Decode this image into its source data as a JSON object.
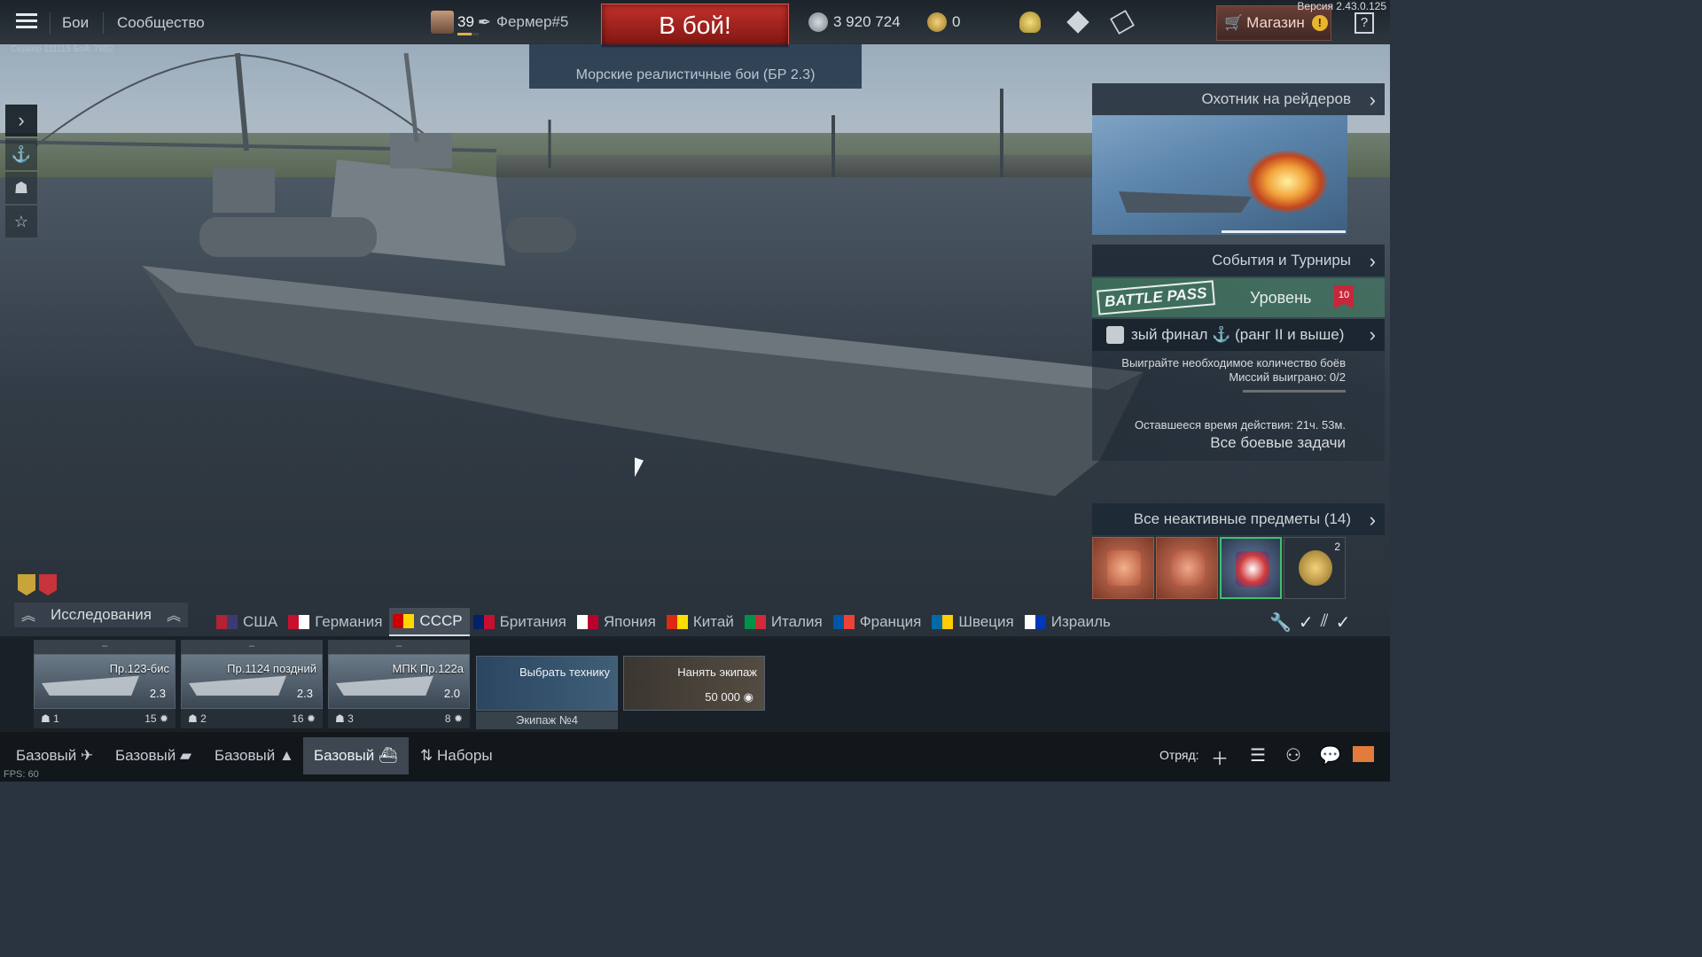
{
  "topbar": {
    "nav": [
      "Бои",
      "Сообщество"
    ],
    "player_level": "39",
    "player_level_progress": 0.65,
    "nickname": "Фермер#5",
    "battle_button": "В бой!",
    "silver_lions": "3 920 724",
    "golden_eagles": "0",
    "shop_label": "Магазин",
    "shop_alert": "!",
    "help": "?",
    "version": "Версия 2.43.0.125",
    "session": "Сервер 111115 Бой: 7882"
  },
  "mode": "Морские реалистичные бои (БР 2.3)",
  "left_tools": [
    "›",
    "⚓",
    "☗",
    "☆"
  ],
  "right_panel": {
    "event_title": "Охотник на рейдеров",
    "events_tournaments": "События и Турниры",
    "battle_pass_tag": "BATTLE PASS",
    "battle_pass_level_label": "Уровень",
    "battle_pass_level": "10",
    "mission_title": "зый финал ⚓ (ранг II и выше)",
    "mission_desc": "Выиграйте необходимое количество боёв",
    "mission_progress": "Миссий выиграно: 0/2",
    "mission_progress_value": 0,
    "mission_time": "Оставшееся время действия: 21ч. 53м.",
    "all_tasks": "Все боевые задачи",
    "inactive_items": "Все неактивные предметы (14)",
    "items": [
      {
        "name": "booster-timer",
        "count": ""
      },
      {
        "name": "booster-silver",
        "count": ""
      },
      {
        "name": "decal-eagle",
        "count": ""
      },
      {
        "name": "coin-bag",
        "count": "2"
      }
    ]
  },
  "research": "Исследования",
  "nations": [
    {
      "name": "США",
      "colors": [
        "#b22234",
        "#3c3b6e"
      ]
    },
    {
      "name": "Германия",
      "colors": [
        "#c8102e",
        "#ffffff"
      ]
    },
    {
      "name": "СССР",
      "colors": [
        "#cc0000",
        "#ffd700"
      ],
      "active": true
    },
    {
      "name": "Британия",
      "colors": [
        "#012169",
        "#c8102e"
      ]
    },
    {
      "name": "Япония",
      "colors": [
        "#ffffff",
        "#bc002d"
      ]
    },
    {
      "name": "Китай",
      "colors": [
        "#de2910",
        "#ffde00"
      ]
    },
    {
      "name": "Италия",
      "colors": [
        "#009246",
        "#ce2b37"
      ]
    },
    {
      "name": "Франция",
      "colors": [
        "#0055a4",
        "#ef4135"
      ]
    },
    {
      "name": "Швеция",
      "colors": [
        "#006aa7",
        "#fecc00"
      ]
    },
    {
      "name": "Израиль",
      "colors": [
        "#ffffff",
        "#0038b8"
      ]
    }
  ],
  "slots": [
    {
      "header": "–",
      "name": "Пр.123-бис",
      "br": "2.3",
      "crew": "1",
      "cost": "15"
    },
    {
      "header": "–",
      "name": "Пр.1124 поздний",
      "br": "2.3",
      "crew": "2",
      "cost": "16"
    },
    {
      "header": "–",
      "name": "МПК Пр.122а",
      "br": "2.0",
      "crew": "3",
      "cost": "8"
    }
  ],
  "actions": {
    "select_vehicle": "Выбрать технику",
    "crew_slot": "Экипаж №4",
    "hire_crew": "Нанять экипаж",
    "hire_price": "50 000"
  },
  "presets": [
    "Базовый ✈",
    "Базовый ▰",
    "Базовый ▲",
    "Базовый ⛴",
    "⇅ Наборы"
  ],
  "squad_label": "Отряд:",
  "fps": "FPS: 60"
}
